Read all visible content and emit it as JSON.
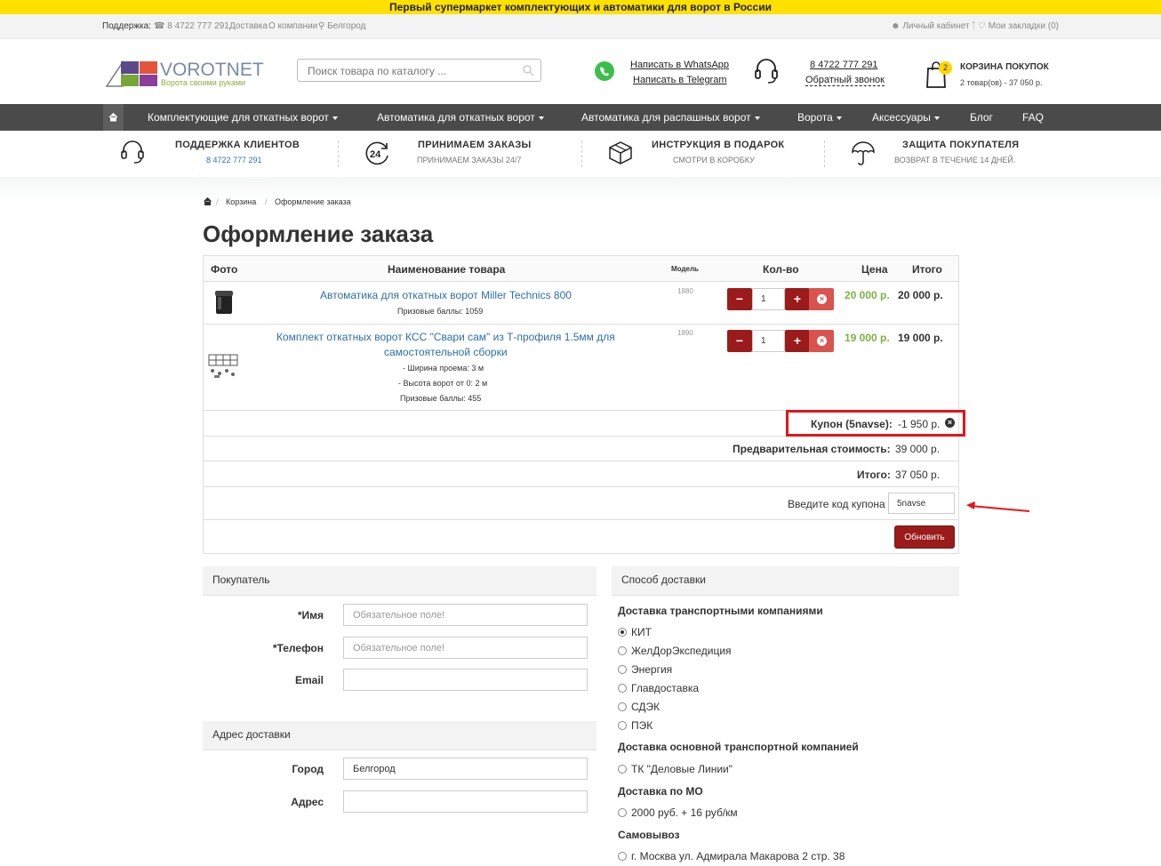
{
  "promo": "Первый супермаркет комплектующих и автоматики для ворот в России",
  "topbar": {
    "support_label": "Поддержка:",
    "phone": "8 4722 777 291",
    "delivery": "Доставка",
    "about": "О компании",
    "city": "Белгород",
    "account": "Личный кабинет",
    "bookmarks": "Мои закладки (0)"
  },
  "logo": {
    "name": "VOROTNET",
    "tagline": "Ворота своими руками"
  },
  "search": {
    "placeholder": "Поиск товара по каталогу ..."
  },
  "messengers": {
    "whatsapp": "Написать в WhatsApp",
    "telegram": "Написать в Telegram"
  },
  "contact": {
    "phone": "8 4722 777 291",
    "callback": "Обратный звонок"
  },
  "cart_header": {
    "title": "КОРЗИНА ПОКУПОК",
    "badge": "2",
    "summary": "2 товар(ов) - 37 050 р."
  },
  "nav": [
    "Комплектующие для откатных ворот",
    "Автоматика для откатных ворот",
    "Автоматика для распашных ворот",
    "Ворота",
    "Аксессуары",
    "Блог",
    "FAQ"
  ],
  "features": [
    {
      "title": "ПОДДЕРЖКА КЛИЕНТОВ",
      "sub": "8 4722 777 291",
      "icon": "headset-icon"
    },
    {
      "title": "ПРИНИМАЕМ ЗАКАЗЫ",
      "sub": "ПРИНИМАЕМ ЗАКАЗЫ 24/7",
      "icon": "24-hours-icon"
    },
    {
      "title": "ИНСТРУКЦИЯ В ПОДАРОК",
      "sub": "СМОТРИ В КОРОБКУ",
      "icon": "box-icon"
    },
    {
      "title": "ЗАЩИТА ПОКУПАТЕЛЯ",
      "sub": "ВОЗВРАТ В ТЕЧЕНИЕ 14 ДНЕЙ.",
      "icon": "umbrella-icon"
    }
  ],
  "breadcrumb": [
    "Корзина",
    "Оформление заказа"
  ],
  "page_title": "Оформление заказа",
  "table": {
    "headers": {
      "photo": "Фото",
      "name": "Наименование товара",
      "model": "Модель",
      "qty": "Кол-во",
      "price": "Цена",
      "total": "Итого"
    },
    "items": [
      {
        "name": "Автоматика для откатных ворот Miller Technics 800",
        "options": [],
        "points": "Призовые баллы: 1059",
        "model": "1880",
        "qty": "1",
        "price": "20 000 р.",
        "total": "20 000 р."
      },
      {
        "name_line1": "Комплект откатных ворот КСС \"Свари сам\" из Т-профиля 1.5мм для",
        "name_line2": "самостоятельной сборки",
        "options": [
          "- Ширина проема: 3 м",
          "- Высота ворот от 0: 2 м"
        ],
        "points": "Призовые баллы: 455",
        "model": "1890",
        "qty": "1",
        "price": "19 000 р.",
        "total": "19 000 р."
      }
    ],
    "coupon_label": "Купон (5navse):",
    "coupon_value": "-1 950 р.",
    "subtotal_label": "Предварительная стоимость:",
    "subtotal_value": "39 000 р.",
    "total_label": "Итого:",
    "total_value": "37 050 р.",
    "coupon_prompt": "Введите код купона",
    "coupon_code": "5navse",
    "update_button": "Обновить"
  },
  "buyer": {
    "title": "Покупатель",
    "name_label": "*Имя",
    "phone_label": "*Телефон",
    "email_label": "Email",
    "required_placeholder": "Обязательное поле!"
  },
  "address": {
    "title": "Адрес доставки",
    "city_label": "Город",
    "city_value": "Белгород",
    "address_label": "Адрес"
  },
  "shipping": {
    "title": "Способ доставки",
    "group1": "Доставка транспортными компаниями",
    "group1_options": [
      "КИТ",
      "ЖелДорЭкспедиция",
      "Энергия",
      "Главдоставка",
      "СДЭК",
      "ПЭК"
    ],
    "group2": "Доставка основной транспортной компанией",
    "group2_options": [
      "ТК \"Деловые Линии\""
    ],
    "group3": "Доставка по МО",
    "group3_options": [
      "2000 руб. + 16 руб/км"
    ],
    "group4": "Самовывоз",
    "group4_options": [
      "г. Москва ул. Адмирала Макарова 2 стр. 38"
    ],
    "selected": "КИТ"
  },
  "colors": {
    "promo": "#ffe100",
    "nav": "#4a4a4a",
    "button": "#9b1b1b",
    "price_green": "#7cb342",
    "link": "#2d6fa8",
    "highlight": "#e4151b"
  }
}
